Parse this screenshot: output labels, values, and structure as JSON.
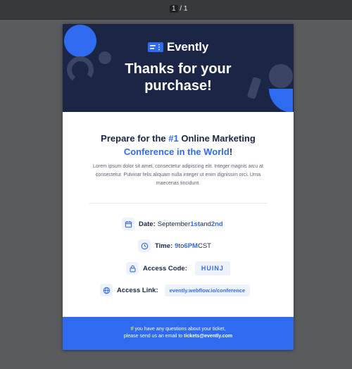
{
  "viewer": {
    "page_current": "1",
    "page_sep": "/",
    "page_total": "1"
  },
  "brand": {
    "name": "Evently",
    "icon": "ticket-icon"
  },
  "hero": {
    "title_line1": "Thanks for your",
    "title_line2": "purchase!"
  },
  "headline": {
    "part1": "Prepare for the ",
    "highlight1": "#1",
    "part2": " Online Marketing",
    "highlight2": "Conference in the World",
    "part3": "!"
  },
  "intro_text": "Lorem ipsum dolor sit amet, consectetur adipiscing elit. Integer magnis arcu at consectetur. Pulvinar felis aliquam nulla integer ut enim dignissim orci. Urna maecenas tincidunt.",
  "details": {
    "date": {
      "icon": "calendar-icon",
      "label": "Date:",
      "text1": "September ",
      "hl1": "1st",
      "text2": " and ",
      "hl2": "2nd"
    },
    "time": {
      "icon": "clock-icon",
      "label": "Time:",
      "hl1": "9",
      "text1": " to ",
      "hl2": "6PM",
      "text2": " CST"
    },
    "access_code": {
      "icon": "lock-icon",
      "label": "Access Code:",
      "value": "HUINJ"
    },
    "access_link": {
      "icon": "globe-icon",
      "label": "Access Link:",
      "value": "evently.webflow.io/conference"
    }
  },
  "footer": {
    "line1": "If you have any questions about your ticket,",
    "line2_prefix": "please send us an email to ",
    "email": "tickets@evently.com"
  },
  "colors": {
    "navy": "#1b2546",
    "accent": "#2f6bf0",
    "page_bg": "#5a5b5d"
  }
}
